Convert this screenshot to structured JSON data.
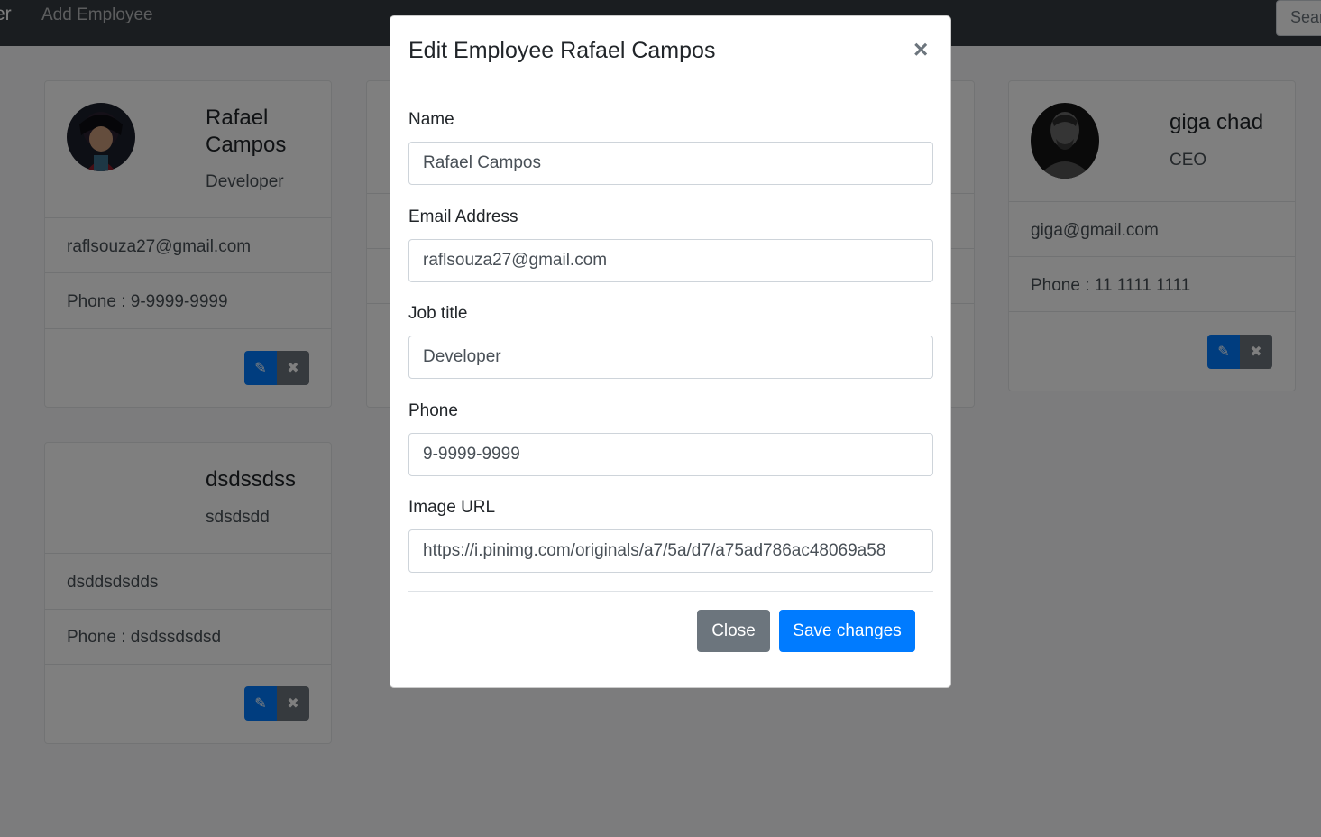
{
  "navbar": {
    "brand": "er",
    "add_employee": "Add Employee",
    "search_placeholder": "Search"
  },
  "cards": [
    {
      "name": "Rafael Campos",
      "title": "Developer",
      "email": "raflsouza27@gmail.com",
      "phone": "Phone : 9-9999-9999"
    },
    {
      "name": "giga chad",
      "title": "CEO",
      "email": "giga@gmail.com",
      "phone": "Phone : 11 1111 1111"
    },
    {
      "name": "dsdssdss",
      "title": "sdsdsdd",
      "email": "dsddsdsdds",
      "phone": "Phone : dsdssdsdsd"
    }
  ],
  "modal": {
    "title": "Edit Employee Rafael Campos",
    "close_icon": "×",
    "fields": {
      "name_label": "Name",
      "name_value": "Rafael Campos",
      "email_label": "Email Address",
      "email_value": "raflsouza27@gmail.com",
      "job_label": "Job title",
      "job_value": "Developer",
      "phone_label": "Phone",
      "phone_value": "9-9999-9999",
      "image_label": "Image URL",
      "image_value": "https://i.pinimg.com/originals/a7/5a/d7/a75ad786ac48069a58"
    },
    "close_button": "Close",
    "save_button": "Save changes"
  },
  "icons": {
    "edit": "pencil-icon",
    "delete": "times-icon"
  },
  "colors": {
    "primary": "#007bff",
    "secondary": "#6c757d",
    "navbar": "#343a40"
  }
}
